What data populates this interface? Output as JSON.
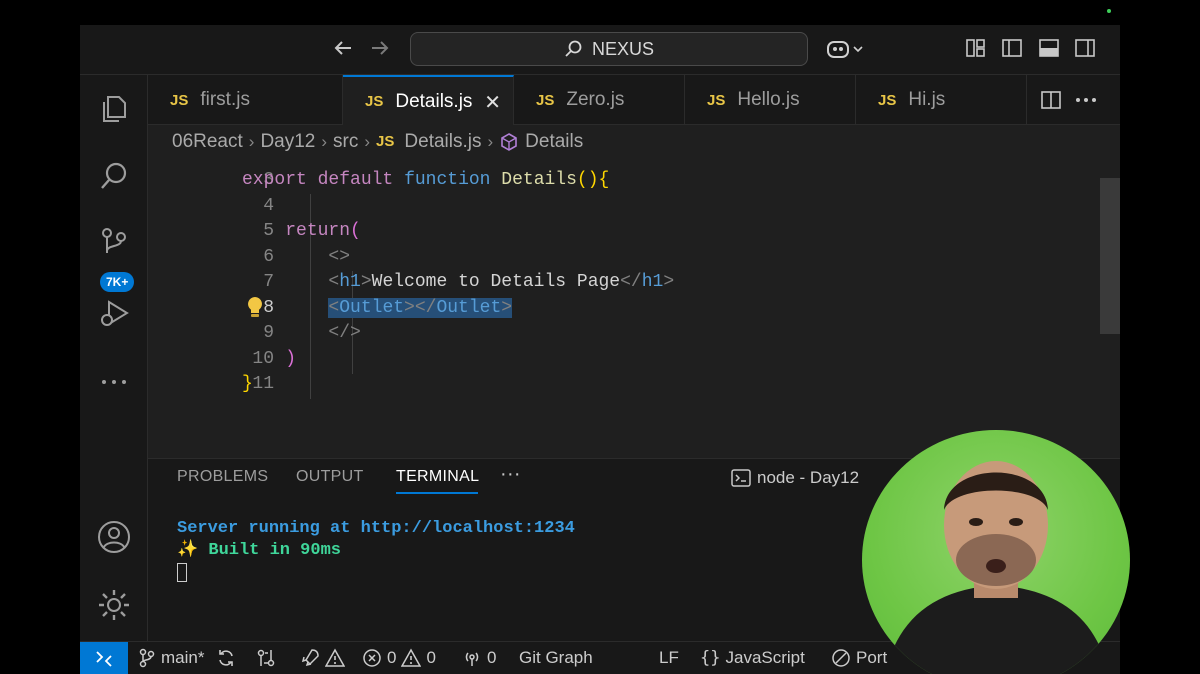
{
  "titlebar": {
    "search_text": "NEXUS",
    "icons": [
      "arrow-left-icon",
      "arrow-right-icon",
      "copilot-icon",
      "layout-customize-icon",
      "toggle-sidebar-icon",
      "toggle-panel-icon",
      "toggle-secondary-sidebar-icon"
    ]
  },
  "activity_bar": {
    "items": [
      "explorer-icon",
      "search-icon",
      "source-control-icon",
      "run-debug-icon",
      "more-icon"
    ],
    "source_control_badge": "7K+",
    "bottom_items": [
      "account-icon",
      "settings-gear-icon"
    ]
  },
  "tabs": [
    {
      "icon": "JS",
      "label": "first.js",
      "active": false
    },
    {
      "icon": "JS",
      "label": "Details.js",
      "active": true
    },
    {
      "icon": "JS",
      "label": "Zero.js",
      "active": false
    },
    {
      "icon": "JS",
      "label": "Hello.js",
      "active": false
    },
    {
      "icon": "JS",
      "label": "Hi.js",
      "active": false
    }
  ],
  "breadcrumb": {
    "parts": [
      "06React",
      "Day12",
      "src"
    ],
    "file_icon": "JS",
    "file": "Details.js",
    "symbol": "Details"
  },
  "editor": {
    "lines": [
      {
        "num": "3",
        "text": "export default function Details(){"
      },
      {
        "num": "4",
        "text": ""
      },
      {
        "num": "5",
        "text": "return("
      },
      {
        "num": "6",
        "text": "<>"
      },
      {
        "num": "7",
        "text": "<h1>Welcome to Details Page</h1>"
      },
      {
        "num": "8",
        "text": "<Outlet></Outlet>"
      },
      {
        "num": "9",
        "text": "</>"
      },
      {
        "num": "10",
        "text": ")"
      },
      {
        "num": "11",
        "text": "}"
      }
    ],
    "tokens": {
      "export": "export",
      "default": "default",
      "function": "function",
      "fn_name": "Details",
      "return": "return",
      "h1": "h1",
      "h1_text": "Welcome to Details Page",
      "outlet": "Outlet"
    },
    "current_line": "8"
  },
  "panel": {
    "tabs": [
      "PROBLEMS",
      "OUTPUT",
      "TERMINAL"
    ],
    "active_tab": "TERMINAL",
    "more": "···",
    "terminal_name": "node - Day12",
    "add_label": "+",
    "terminal_lines": [
      "Server running at http://localhost:1234",
      "✨ Built in 90ms"
    ]
  },
  "statusbar": {
    "branch": "main*",
    "errors": "0",
    "warnings": "0",
    "ports_count": "0",
    "git_graph": "Git Graph",
    "eol": "LF",
    "language": "JavaScript",
    "port": "Port"
  },
  "colors": {
    "accent": "#0078d4",
    "keyword": "#c586c0",
    "storage": "#569cd6",
    "function": "#dcdcaa",
    "terminal_blue": "#3b9ce0",
    "terminal_green": "#3fd69a"
  }
}
